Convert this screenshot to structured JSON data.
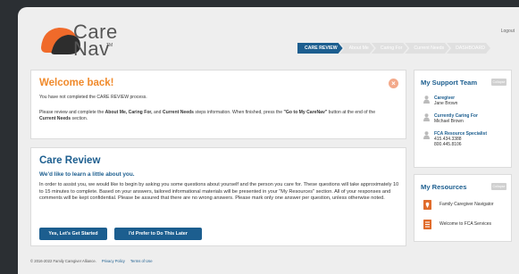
{
  "header": {
    "logo_line1": "Care",
    "logo_line2": "Nav",
    "logo_tm": "TM",
    "logout": "Logout",
    "steps": [
      "CARE REVIEW",
      "About Me",
      "Caring For",
      "Current Needs",
      "DASHBOARD"
    ]
  },
  "welcome": {
    "title": "Welcome back!",
    "p1": "You have not completed the CARE REVIEW process.",
    "p2_a": "Please review and complete the ",
    "p2_about": "About Me, Caring For,",
    "p2_b": " and ",
    "p2_needs": "Current Needs",
    "p2_c": " steps information. When finished, press the ",
    "p2_goto": "\"Go to My CareNav\"",
    "p2_d": " button at the end of the ",
    "p2_section": "Current Needs",
    "p2_e": " section."
  },
  "review": {
    "title": "Care Review",
    "subtitle": "We'd like to learn a little about you.",
    "body": "In order to assist you, we would like to begin by asking you some questions about yourself and the person you care for. These questions will take approximately 10 to 15 minutes to complete. Based on your answers, tailored informational materials will be presented in your \"My Resources\" section. All of your responses and comments will be kept confidential. Please be assured that there are no wrong answers. Please mark only one answer per question, unless otherwise noted.",
    "btn_start": "Yes, Let's Get Started",
    "btn_later": "I'd Prefer to Do This Later"
  },
  "support": {
    "title": "My Support Team",
    "collapse": "Collapse",
    "members": [
      {
        "role": "Caregiver",
        "name": "Jane Brown",
        "extra1": "",
        "extra2": ""
      },
      {
        "role": "Currently Caring For",
        "name": "Michael Brown",
        "extra1": "",
        "extra2": ""
      },
      {
        "role": "FCA Resource Specialist",
        "name": "415.434.3388",
        "extra1": "800.445.8106",
        "extra2": ""
      }
    ]
  },
  "resources": {
    "title": "My Resources",
    "collapse": "Collapse",
    "items": [
      "Family Caregiver Navigator",
      "Welcome to FCA Services"
    ]
  },
  "footer": {
    "copyright": "© 2016-2022 Family Caregiver Alliance.",
    "privacy": "Privacy Policy",
    "terms": "Terms of Use"
  },
  "colors": {
    "brand_blue": "#1c5e8f",
    "brand_orange": "#f08a2c",
    "step_inactive": "#e0e0e0"
  }
}
